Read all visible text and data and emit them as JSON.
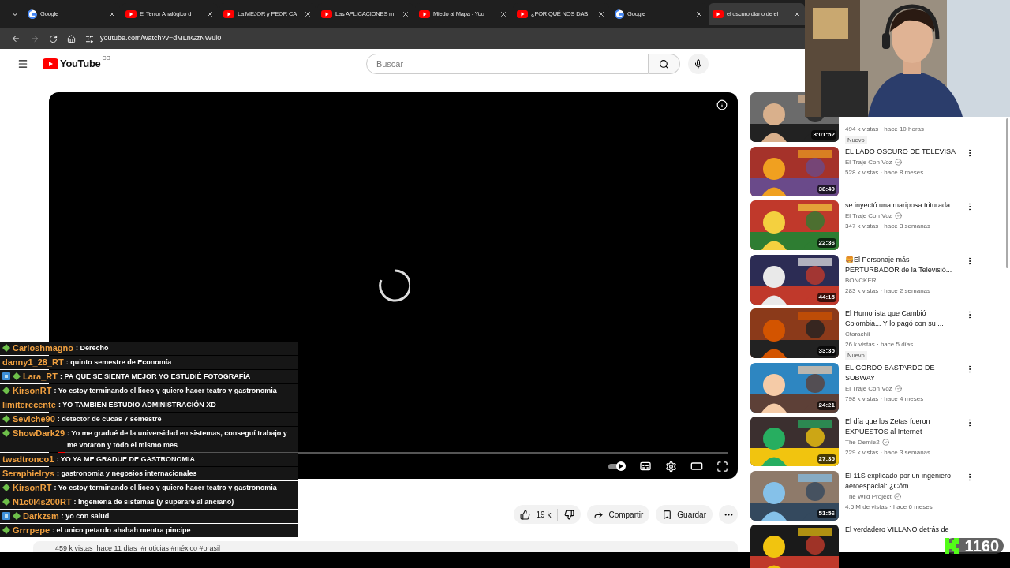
{
  "browser": {
    "tabs": [
      {
        "kind": "google",
        "title": "Google",
        "selected": false
      },
      {
        "kind": "youtube",
        "title": "El Terror Analógico d",
        "selected": false
      },
      {
        "kind": "youtube",
        "title": "La MEJOR y PEOR CA",
        "selected": false
      },
      {
        "kind": "youtube",
        "title": "Las APLICACIONES m",
        "selected": false
      },
      {
        "kind": "youtube",
        "title": "Miedo al Mapa - You",
        "selected": false
      },
      {
        "kind": "youtube",
        "title": "¿POR QUÉ NOS DAB",
        "selected": false
      },
      {
        "kind": "google",
        "title": "Google",
        "selected": false
      },
      {
        "kind": "youtube",
        "title": "el oscuro diario de el",
        "selected": true
      }
    ],
    "url": "youtube.com/watch?v=dMLnGzNWui0"
  },
  "header": {
    "logo": "YouTube",
    "country": "CO",
    "search": {
      "placeholder": "Buscar"
    }
  },
  "player": {
    "autoplay": true,
    "level": 0.01
  },
  "actions": {
    "likes": "19 k",
    "share": "Compartir",
    "save": "Guardar"
  },
  "video_stats": "459 k vistas  hace 11 días  #noticias #méxico #brasil",
  "sidebar": {
    "videos": [
      {
        "views": "494 k vistas · hace 10 horas",
        "badge": "Nuevo",
        "duration": "3:01:52"
      },
      {
        "title": "EL LADO OSCURO DE TELEVISA",
        "channel": "El Traje Con Voz",
        "verified": true,
        "views": "528 k vistas · hace 8 meses",
        "duration": "38:40"
      },
      {
        "title": "se inyectó una mariposa triturada",
        "channel": "El Traje Con Voz",
        "verified": true,
        "views": "347 k vistas · hace 3 semanas",
        "duration": "22:36"
      },
      {
        "title": "🍔El Personaje más PERTURBADOR de la Televisió...",
        "channel": "BONCKER",
        "verified": false,
        "views": "283 k vistas · hace 2 semanas",
        "duration": "44:15"
      },
      {
        "title": "El Humorista que Cambió Colombia... Y lo pagó con su ...",
        "channel": "Ctarachii",
        "verified": false,
        "views": "26 k vistas · hace 5 días",
        "badge": "Nuevo",
        "duration": "33:35"
      },
      {
        "title": "EL GORDO BASTARDO DE SUBWAY",
        "channel": "El Traje Con Voz",
        "verified": true,
        "views": "798 k vistas · hace 4 meses",
        "duration": "24:21"
      },
      {
        "title": "El día que los Zetas fueron EXPUESTOS al Internet",
        "channel": "The Demie2",
        "verified": true,
        "views": "229 k vistas · hace 3 semanas",
        "duration": "27:35"
      },
      {
        "title": "El 11S explicado por un ingeniero aeroespacial: ¿Cóm...",
        "channel": "The Wild Project",
        "verified": true,
        "views": "4.5 M de vistas · hace 6 meses",
        "duration": "51:56"
      },
      {
        "title": "El verdadero VILLANO detrás de"
      }
    ]
  },
  "chat": [
    {
      "kind": "sub",
      "user": "Carloshmagno",
      "text": ": Derecho"
    },
    {
      "kind": "plain",
      "user": "danny1_28_RT",
      "text": ": quinto semestre de Economía"
    },
    {
      "kind": "vip",
      "user": "Lara_RT",
      "text": ": PA QUE SE SIENTA MEJOR YO ESTUDIÉ FOTOGRAFÍA"
    },
    {
      "kind": "sub",
      "user": "KirsonRT",
      "text": ": Yo estoy terminando el liceo y quiero hacer teatro y gastronomia"
    },
    {
      "kind": "plain",
      "user": "limiterecente",
      "text": ": YO TAMBIEN ESTUDIO ADMINISTRACIÓN XD"
    },
    {
      "kind": "sub",
      "user": "Seviche90",
      "text": ": detector de cucas 7 semestre"
    },
    {
      "kind": "sub",
      "user": "ShowDark29",
      "text": ": Yo me gradué de la universidad en sistemas, conseguí trabajo y me votaron y todo el mismo mes"
    },
    {
      "kind": "plain",
      "user": "twsdtronco1",
      "text": ": YO YA ME GRADUE DE GASTRONOMIA"
    },
    {
      "kind": "plain",
      "user": "Seraphielrys",
      "text": ": gastronomia y negosios internacionales"
    },
    {
      "kind": "sub",
      "user": "KirsonRT",
      "text": ": Yo estoy terminando el liceo y quiero hacer teatro y gastronomia"
    },
    {
      "kind": "sub",
      "user": "N1c0l4s200RT",
      "text": ": Ingenieria de sistemas (y superaré al anciano)"
    },
    {
      "kind": "vip",
      "user": "Darkzsm",
      "text": ": yo con salud"
    },
    {
      "kind": "sub",
      "user": "Grrrpepe",
      "text": ": el unico petardo ahahah mentra pincipe"
    }
  ],
  "viewer_count": "1160"
}
